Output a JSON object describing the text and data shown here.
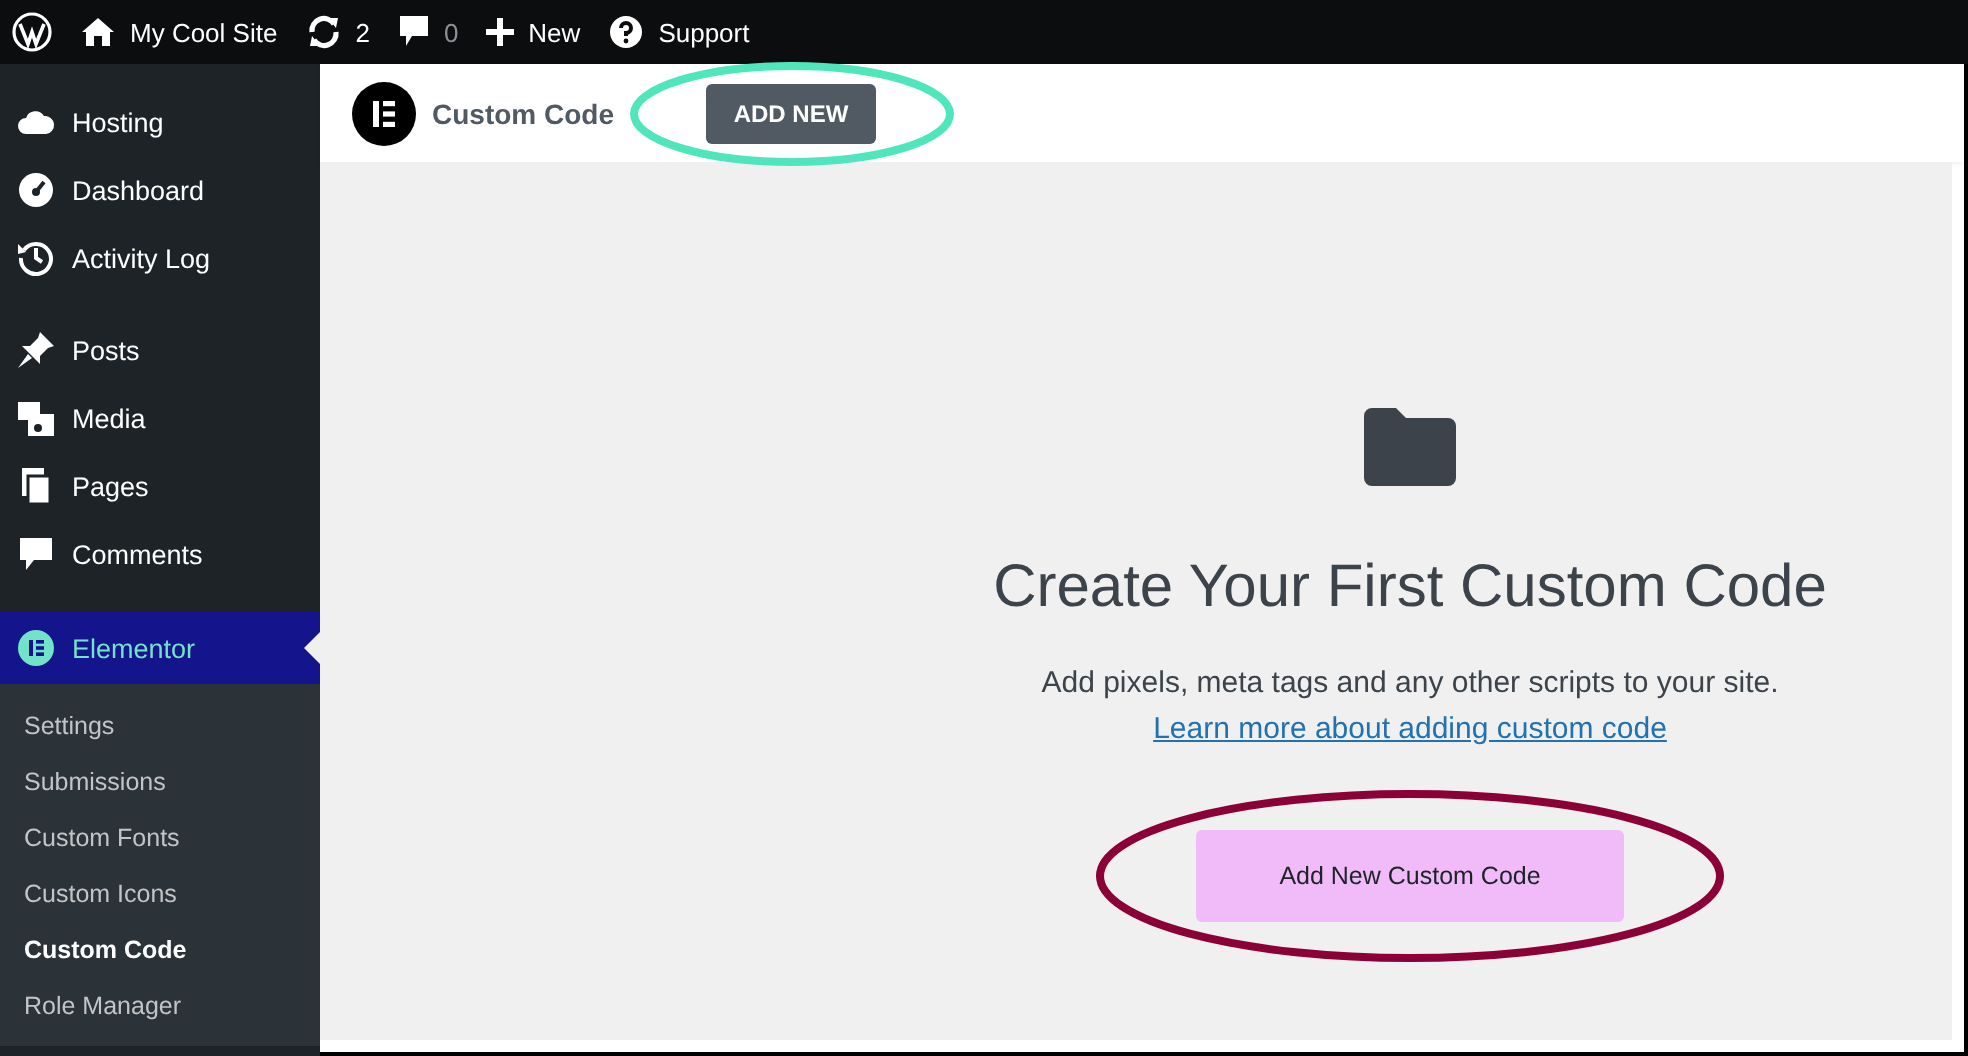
{
  "admin_bar": {
    "items": [
      {
        "kind": "logo"
      },
      {
        "kind": "site",
        "label": "My Cool Site"
      },
      {
        "kind": "updates",
        "label": "2"
      },
      {
        "kind": "comments",
        "label": "0"
      },
      {
        "kind": "new",
        "label": "New"
      },
      {
        "kind": "support",
        "label": "Support"
      }
    ]
  },
  "sidebar": {
    "groups": [
      [
        {
          "kind": "cloud",
          "label": "Hosting",
          "selected": false
        },
        {
          "kind": "gauge",
          "label": "Dashboard",
          "selected": false
        },
        {
          "kind": "history",
          "label": "Activity Log",
          "selected": false
        }
      ],
      [
        {
          "kind": "pin",
          "label": "Posts",
          "selected": false
        },
        {
          "kind": "media",
          "label": "Media",
          "selected": false
        },
        {
          "kind": "pages",
          "label": "Pages",
          "selected": false
        },
        {
          "kind": "comment",
          "label": "Comments",
          "selected": false
        }
      ],
      [
        {
          "kind": "elementor",
          "label": "Elementor",
          "selected": true,
          "children": [
            {
              "label": "Settings",
              "selected": false
            },
            {
              "label": "Submissions",
              "selected": false
            },
            {
              "label": "Custom Fonts",
              "selected": false
            },
            {
              "label": "Custom Icons",
              "selected": false
            },
            {
              "label": "Custom Code",
              "selected": true
            },
            {
              "label": "Role Manager",
              "selected": false
            }
          ]
        }
      ]
    ]
  },
  "header": {
    "title": "Custom Code",
    "button": "ADD NEW"
  },
  "empty_state": {
    "title": "Create Your First Custom Code",
    "description": "Add pixels, meta tags and any other scripts to your site.",
    "link": "Learn more about adding custom code",
    "button": "Add New Custom Code"
  }
}
